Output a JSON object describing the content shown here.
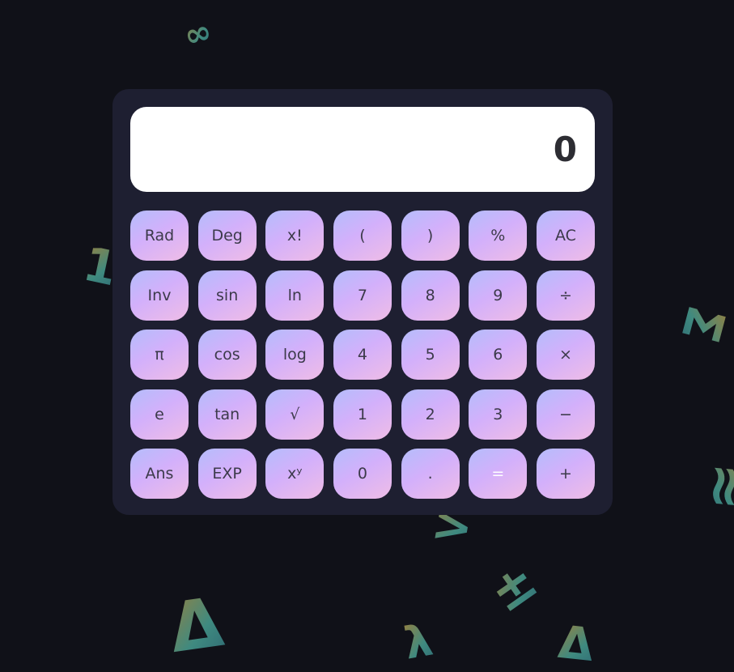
{
  "display": {
    "value": "0"
  },
  "keys": [
    {
      "name": "rad-key",
      "label": "Rad"
    },
    {
      "name": "deg-key",
      "label": "Deg"
    },
    {
      "name": "factorial-key",
      "label": "x!"
    },
    {
      "name": "open-paren-key",
      "label": "("
    },
    {
      "name": "close-paren-key",
      "label": ")"
    },
    {
      "name": "percent-key",
      "label": "%"
    },
    {
      "name": "all-clear-key",
      "label": "AC"
    },
    {
      "name": "inverse-key",
      "label": "Inv"
    },
    {
      "name": "sin-key",
      "label": "sin"
    },
    {
      "name": "ln-key",
      "label": "ln"
    },
    {
      "name": "digit-7-key",
      "label": "7"
    },
    {
      "name": "digit-8-key",
      "label": "8"
    },
    {
      "name": "digit-9-key",
      "label": "9"
    },
    {
      "name": "divide-key",
      "label": "÷"
    },
    {
      "name": "pi-key",
      "label": "π"
    },
    {
      "name": "cos-key",
      "label": "cos"
    },
    {
      "name": "log-key",
      "label": "log"
    },
    {
      "name": "digit-4-key",
      "label": "4"
    },
    {
      "name": "digit-5-key",
      "label": "5"
    },
    {
      "name": "digit-6-key",
      "label": "6"
    },
    {
      "name": "multiply-key",
      "label": "×"
    },
    {
      "name": "euler-key",
      "label": "e"
    },
    {
      "name": "tan-key",
      "label": "tan"
    },
    {
      "name": "sqrt-key",
      "label": "√"
    },
    {
      "name": "digit-1-key",
      "label": "1"
    },
    {
      "name": "digit-2-key",
      "label": "2"
    },
    {
      "name": "digit-3-key",
      "label": "3"
    },
    {
      "name": "subtract-key",
      "label": "−"
    },
    {
      "name": "answer-key",
      "label": "Ans"
    },
    {
      "name": "exp-key",
      "label": "EXP"
    },
    {
      "name": "power-key",
      "label": "xʸ"
    },
    {
      "name": "digit-0-key",
      "label": "0"
    },
    {
      "name": "decimal-key",
      "label": "."
    },
    {
      "name": "equals-key",
      "label": "="
    },
    {
      "name": "add-key",
      "label": "+"
    }
  ],
  "background_symbols": [
    {
      "name": "infinity-symbol",
      "glyph": "∞"
    },
    {
      "name": "one-symbol",
      "glyph": "1"
    },
    {
      "name": "sigma-symbol",
      "glyph": "Σ"
    },
    {
      "name": "approx-symbol",
      "glyph": "≈"
    },
    {
      "name": "greater-than-symbol",
      "glyph": ">"
    },
    {
      "name": "plus-minus-symbol",
      "glyph": "±"
    },
    {
      "name": "delta-symbol",
      "glyph": "Δ"
    },
    {
      "name": "lambda-symbol",
      "glyph": "λ"
    },
    {
      "name": "triangle-symbol",
      "glyph": "Δ"
    }
  ],
  "colors": {
    "page_background": "#101118",
    "calculator_body": "#1e1f31",
    "display_background": "#ffffff",
    "key_gradient_start": "#b4bdfb",
    "key_gradient_mid": "#d3b0fb",
    "key_gradient_end": "#efbde6",
    "key_text": "#3c3a4a",
    "equals_text": "#ffffff"
  }
}
